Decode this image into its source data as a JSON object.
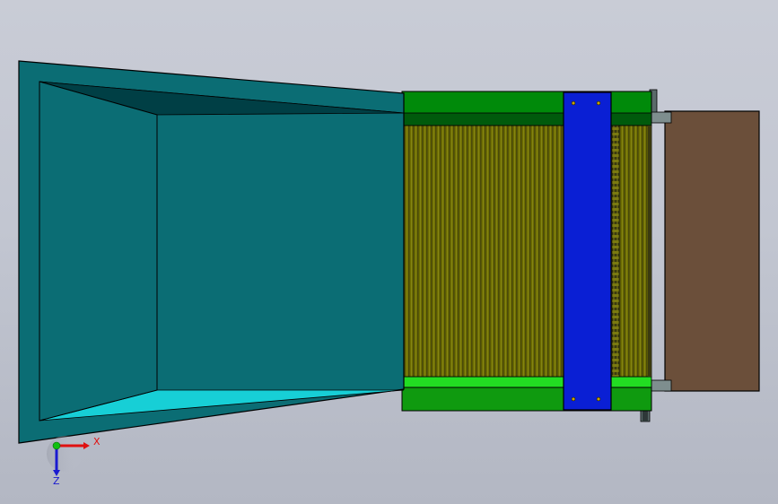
{
  "viewport": {
    "background_top": "#c9ccd6",
    "background_bottom": "#b3b7c3"
  },
  "colors": {
    "hopper_teal": "#0b6d74",
    "hopper_dark": "#00474e",
    "hopper_light": "#17cfd6",
    "frame_green": "#00850a",
    "frame_bright_green": "#1fdb1f",
    "frame_dark_green": "#004f0a",
    "belt_olive": "#6a6a00",
    "belt_slat_dark": "#4a4a0a",
    "cross_beam_blue": "#0a1fd4",
    "plate_brown": "#6b4f3a"
  },
  "triad": {
    "x_label": "X",
    "z_label": "Z",
    "x_color": "#e01010",
    "y_color": "#10c010",
    "z_color": "#1a1ad0"
  }
}
